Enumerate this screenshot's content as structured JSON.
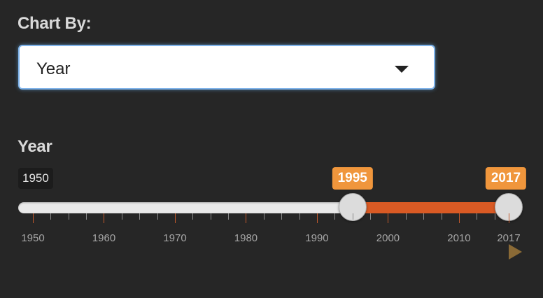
{
  "chart_by": {
    "label": "Chart By:",
    "selected": "Year"
  },
  "year_slider": {
    "label": "Year",
    "min": 1950,
    "max": 2017,
    "min_label": "1950",
    "from": 1995,
    "to": 2017,
    "from_label": "1995",
    "to_label": "2017",
    "tick_labels": [
      "1950",
      "1960",
      "1970",
      "1980",
      "1990",
      "2000",
      "2010",
      "2017"
    ],
    "tick_values": [
      1950,
      1960,
      1970,
      1980,
      1990,
      2000,
      2010,
      2017
    ],
    "accent_color": "#d95a24",
    "bubble_color": "#f0963c"
  },
  "icons": {
    "dropdown": "chevron-down-icon",
    "play": "play-icon"
  }
}
